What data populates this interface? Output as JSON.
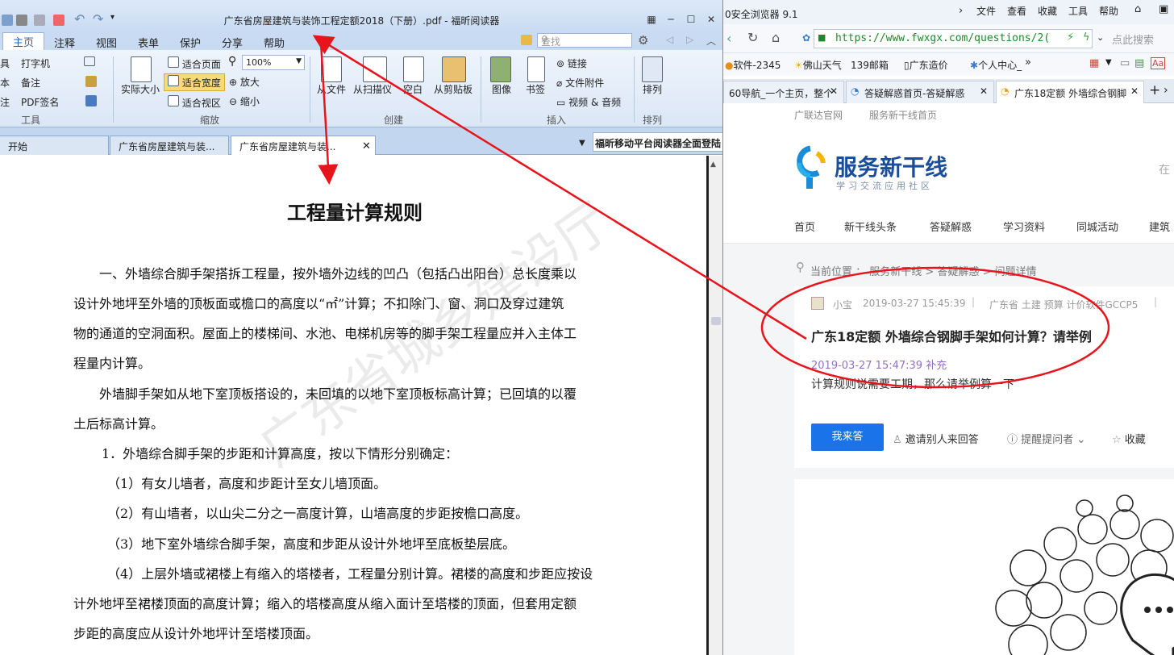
{
  "reader": {
    "title": "广东省房屋建筑与装饰工程定额2018（下册）.pdf - 福昕阅读器",
    "menu_tabs": [
      "主页",
      "注释",
      "视图",
      "表单",
      "保护",
      "分享",
      "帮助"
    ],
    "search_placeholder": "查找",
    "ribbon": {
      "tools": [
        "具",
        "打字机",
        "本",
        "备注",
        "注",
        "PDF签名"
      ],
      "tools_group": "工具",
      "actual_size": "实际大小",
      "fit_page": "适合页面",
      "fit_width": "适合宽度",
      "fit_view": "适合视区",
      "zoom_value": "100%",
      "zoom_in": "放大",
      "zoom_out": "缩小",
      "zoom_group": "缩放",
      "from_file": "从文件",
      "from_scanner": "从扫描仪",
      "blank": "空白",
      "from_clipboard": "从剪贴板",
      "create_group": "创建",
      "image": "图像",
      "bookmark": "书签",
      "link": "链接",
      "file_attachment": "文件附件",
      "video_audio": "视频 & 音频",
      "insert_group": "插入",
      "arrange": "排列",
      "arrange_group": "排列"
    },
    "doc_tabs": [
      "开始",
      "广东省房屋建筑与装...",
      "广东省房屋建筑与装..."
    ],
    "ad_text": "福昕移动平台阅读器全面登陆",
    "doc": {
      "title": "工程量计算规则",
      "lines": [
        "一、外墙综合脚手架搭拆工程量，按外墙外边线的凹凸（包括凸出阳台）总长度乘以",
        "设计外地坪至外墙的顶板面或檐口的高度以“㎡”计算；不扣除门、窗、洞口及穿过建筑",
        "物的通道的空洞面积。屋面上的楼梯间、水池、电梯机房等的脚手架工程量应并入主体工",
        "程量内计算。",
        "外墙脚手架如从地下室顶板搭设的，未回填的以地下室顶板标高计算；已回填的以覆",
        "土后标高计算。",
        "1．外墙综合脚手架的步距和计算高度，按以下情形分别确定：",
        "（1）有女儿墙者，高度和步距计至女儿墙顶面。",
        "（2）有山墙者，以山尖二分之一高度计算，山墙高度的步距按檐口高度。",
        "（3）地下室外墙综合脚手架，高度和步距从设计外地坪至底板垫层底。",
        "（4）上层外墙或裙楼上有缩入的塔楼者，工程量分别计算。裙楼的高度和步距应按设",
        "计外地坪至裙楼顶面的高度计算；缩入的塔楼高度从缩入面计至塔楼的顶面，但套用定额",
        "步距的高度应从设计外地坪计至塔楼顶面。"
      ],
      "watermark": "广东省城乡建设厅"
    }
  },
  "browser": {
    "title": "0安全浏览器 9.1",
    "menu": [
      "文件",
      "查看",
      "收藏",
      "工具",
      "帮助"
    ],
    "url": "https://www.fwxgx.com/questions/2(",
    "search_hint": "点此搜索",
    "favorites": [
      "软件-2345",
      "佛山天气",
      "139邮箱",
      "广东造价",
      "个人中心_"
    ],
    "tabs": [
      "60导航_一个主页，整个",
      "答疑解惑首页-答疑解惑",
      "广东18定额 外墙综合钢脚"
    ],
    "site": {
      "top_links": [
        "广联达官网",
        "服务新干线首页"
      ],
      "logo_name": "服务新干线",
      "logo_slogan": "学习交流应用社区",
      "nav": [
        "首页",
        "新干线头条",
        "答疑解惑",
        "学习资料",
        "同城活动",
        "建筑"
      ],
      "breadcrumb": "当前位置 ： 服务新干线 > 答疑解惑 > 问题详情",
      "question": {
        "author": "小宝",
        "time": "2019-03-27 15:45:39",
        "tags": "广东省  土建  预算  计价软件GCCP5",
        "title": "广东18定额 外墙综合钢脚手架如何计算？请举例",
        "supplement_time": "2019-03-27 15:47:39 补充",
        "body": "计算规则说需要工期，那么请举例算一下",
        "answer_button": "我来答",
        "invite": "邀请别人来回答",
        "remind": "提醒提问者",
        "favorite": "收藏"
      }
    }
  },
  "colors": {
    "annotation_red": "#e8141c",
    "brand_blue": "#1a73e8",
    "reader_blue": "#c8dbf3"
  }
}
